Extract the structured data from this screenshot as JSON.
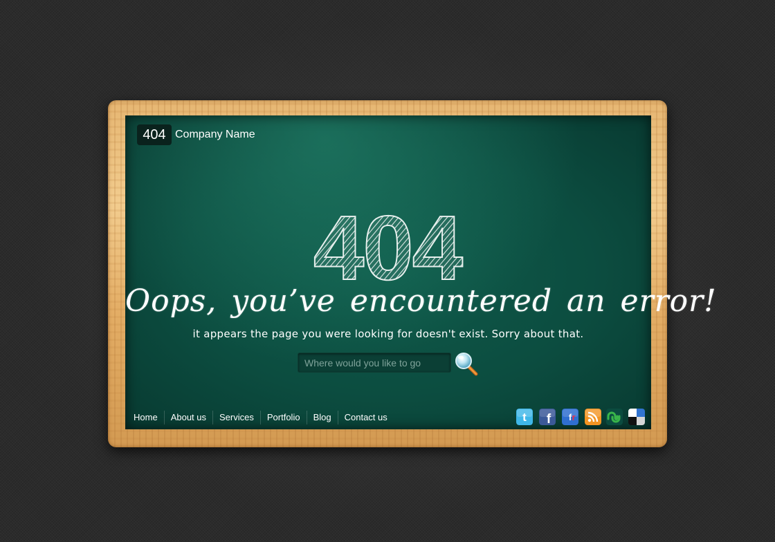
{
  "logo": {
    "badge": "404",
    "company": "Company Name"
  },
  "error": {
    "code": "404",
    "headline": "Oops, you’ve encountered an error!",
    "message": "it appears the page you were looking for doesn't exist. Sorry about that."
  },
  "search": {
    "placeholder": "Where would you like to go"
  },
  "nav": {
    "items": [
      {
        "label": "Home"
      },
      {
        "label": "About us"
      },
      {
        "label": "Services"
      },
      {
        "label": "Portfolio"
      },
      {
        "label": "Blog"
      },
      {
        "label": "Contact us"
      }
    ]
  },
  "social": {
    "icons": [
      "twitter-icon",
      "facebook-icon",
      "friendfeed-icon",
      "rss-icon",
      "stumbleupon-icon",
      "delicious-icon"
    ]
  },
  "colors": {
    "background": "#2b2b2b",
    "board_green": "#0c4d40",
    "frame_wood": "#e6b672",
    "chalk": "#ffffff"
  }
}
